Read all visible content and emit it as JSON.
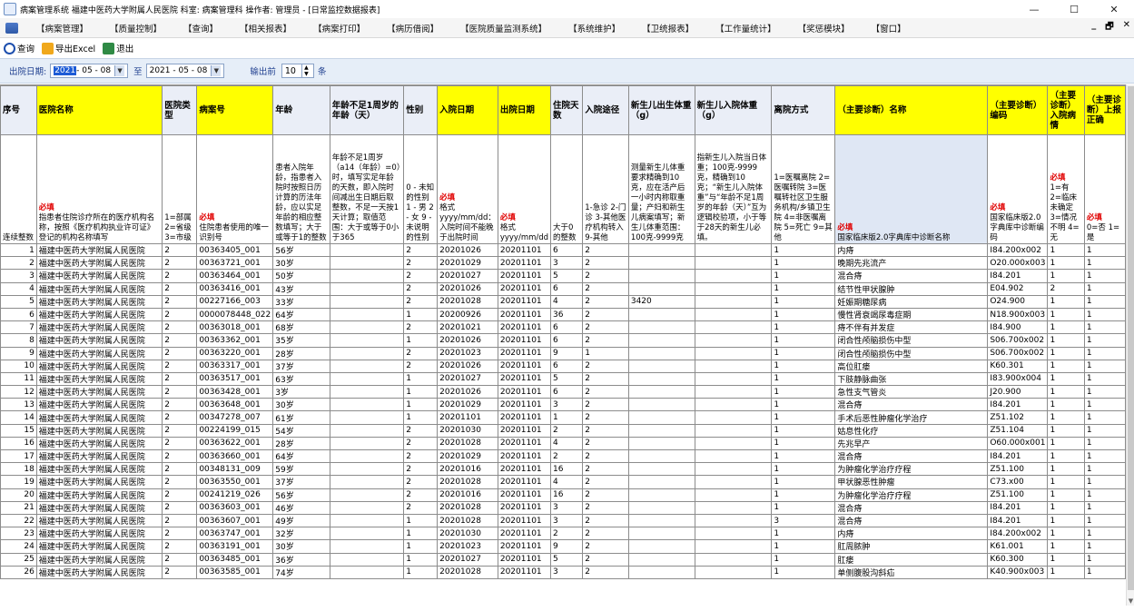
{
  "window": {
    "title": "病案管理系统 福建中医药大学附属人民医院 科室: 病案管理科 操作者: 管理员 - [日常监控数据报表]",
    "min_label": "—",
    "max_label": "☐",
    "close_label": "✕"
  },
  "menu": {
    "items": [
      "【病案管理】",
      "【质量控制】",
      "【查询】",
      "【相关报表】",
      "【病案打印】",
      "【病历借阅】",
      "【医院质量监测系统】",
      "【系统维护】",
      "【卫统报表】",
      "【工作量统计】",
      "【奖惩模块】",
      "【窗口】"
    ],
    "mdi_min": "_",
    "mdi_restore": "🗗",
    "mdi_close": "✕"
  },
  "toolbar": {
    "query": "查询",
    "export": "导出Excel",
    "exit": "退出"
  },
  "filter": {
    "label": "出院日期:",
    "from_year": "2021",
    "from_rest": " - 05 - 08",
    "to_label": "至",
    "to_date": "2021 - 05 - 08",
    "top_label": "输出前",
    "top_value": "10",
    "unit": "条"
  },
  "columns": [
    {
      "h": "序号",
      "d": "连续整数",
      "req": ""
    },
    {
      "h": "医院名称",
      "d": "指患者住院诊疗所在的医疗机构名称，按照《医疗机构执业许可证》登记的机构名称填写",
      "req": "必填"
    },
    {
      "h": "医院类型",
      "d": "1=部属 2=省级 3=市级",
      "req": ""
    },
    {
      "h": "病案号",
      "d": "住院患者使用的唯一识别号",
      "req": "必填"
    },
    {
      "h": "年龄",
      "d": "患者入院年龄，指患者入院时按照日历计算的历法年龄，应以实足年龄的相应整数填写；大于或等于1的整数",
      "req": ""
    },
    {
      "h": "年龄不足1周岁的年龄（天）",
      "d": "年龄不足1周岁（a14（年龄）=0）时，填写实足年龄的天数，即入院时间减出生日期后取整数，不足一天按1天计算；取值范围：大于或等于0小于365",
      "req": ""
    },
    {
      "h": "性别",
      "d": "0 - 未知的性别 1 - 男 2 - 女 9 - 未说明的性别",
      "req": ""
    },
    {
      "h": "入院日期",
      "d": "格式yyyy/mm/dd：入院时间不能晚于出院时间",
      "req": "必填"
    },
    {
      "h": "出院日期",
      "d": "格式yyyy/mm/dd",
      "req": "必填"
    },
    {
      "h": "住院天数",
      "d": "大于0的整数",
      "req": ""
    },
    {
      "h": "入院途径",
      "d": "1-急诊 2-门诊 3-其他医疗机构转入 9-其他",
      "req": ""
    },
    {
      "h": "新生儿出生体重（g）",
      "d": "测量新生儿体重要求精确到10克，应在活产后一小时内称取重量；产妇和新生儿病案填写；新生儿体重范围：100克-9999克",
      "req": ""
    },
    {
      "h": "新生儿入院体重（g）",
      "d": "指新生儿入院当日体重；100克-9999克，精确到10克；“新生儿入院体重”与“年龄不足1周岁的年龄（天）”互为逻辑校验项，小于等于28天的新生儿必填。",
      "req": ""
    },
    {
      "h": "离院方式",
      "d": "1=医嘱离院 2=医嘱转院 3=医嘱转社区卫生服务机构/乡镇卫生院 4=非医嘱离院 5=死亡 9=其他",
      "req": ""
    },
    {
      "h": "（主要诊断）名称",
      "d": "国家临床版2.0字典库中诊断名称",
      "req": "必填"
    },
    {
      "h": "（主要诊断）编码",
      "d": "国家临床版2.0字典库中诊断编码",
      "req": "必填"
    },
    {
      "h": "（主要诊断）入院病情",
      "d": "1=有 2=临床未确定 3=情况不明 4=无",
      "req": "必填"
    },
    {
      "h": "（主要诊断）上报正确",
      "d": "0=否 1=是",
      "req": "必填"
    }
  ],
  "rows": [
    [
      "1",
      "福建中医药大学附属人民医院",
      "2",
      "00363405_001",
      "56岁",
      "",
      "2",
      "20201026",
      "20201101",
      "6",
      "2",
      "",
      "",
      "1",
      "内痔",
      "I84.200x002",
      "1",
      "1"
    ],
    [
      "2",
      "福建中医药大学附属人民医院",
      "2",
      "00363721_001",
      "30岁",
      "",
      "2",
      "20201029",
      "20201101",
      "3",
      "2",
      "",
      "",
      "1",
      "晚期先兆流产",
      "O20.000x003",
      "1",
      "1"
    ],
    [
      "3",
      "福建中医药大学附属人民医院",
      "2",
      "00363464_001",
      "50岁",
      "",
      "2",
      "20201027",
      "20201101",
      "5",
      "2",
      "",
      "",
      "1",
      "混合痔",
      "I84.201",
      "1",
      "1"
    ],
    [
      "4",
      "福建中医药大学附属人民医院",
      "2",
      "00363416_001",
      "43岁",
      "",
      "2",
      "20201026",
      "20201101",
      "6",
      "2",
      "",
      "",
      "1",
      "结节性甲状腺肿",
      "E04.902",
      "2",
      "1"
    ],
    [
      "5",
      "福建中医药大学附属人民医院",
      "2",
      "00227166_003",
      "33岁",
      "",
      "2",
      "20201028",
      "20201101",
      "4",
      "2",
      "3420",
      "",
      "1",
      "妊娠期糖尿病",
      "O24.900",
      "1",
      "1"
    ],
    [
      "6",
      "福建中医药大学附属人民医院",
      "2",
      "0000078448_022",
      "64岁",
      "",
      "1",
      "20200926",
      "20201101",
      "36",
      "2",
      "",
      "",
      "1",
      "慢性肾衰竭尿毒症期",
      "N18.900x003",
      "1",
      "1"
    ],
    [
      "7",
      "福建中医药大学附属人民医院",
      "2",
      "00363018_001",
      "68岁",
      "",
      "2",
      "20201021",
      "20201101",
      "6",
      "2",
      "",
      "",
      "1",
      "痔不伴有并发症",
      "I84.900",
      "1",
      "1"
    ],
    [
      "8",
      "福建中医药大学附属人民医院",
      "2",
      "00363362_001",
      "35岁",
      "",
      "1",
      "20201026",
      "20201101",
      "6",
      "2",
      "",
      "",
      "1",
      "闭合性颅脑损伤中型",
      "S06.700x002",
      "1",
      "1"
    ],
    [
      "9",
      "福建中医药大学附属人民医院",
      "2",
      "00363220_001",
      "28岁",
      "",
      "2",
      "20201023",
      "20201101",
      "9",
      "1",
      "",
      "",
      "1",
      "闭合性颅脑损伤中型",
      "S06.700x002",
      "1",
      "1"
    ],
    [
      "10",
      "福建中医药大学附属人民医院",
      "2",
      "00363317_001",
      "37岁",
      "",
      "2",
      "20201026",
      "20201101",
      "6",
      "2",
      "",
      "",
      "1",
      "高位肛瘘",
      "K60.301",
      "1",
      "1"
    ],
    [
      "11",
      "福建中医药大学附属人民医院",
      "2",
      "00363517_001",
      "63岁",
      "",
      "1",
      "20201027",
      "20201101",
      "5",
      "2",
      "",
      "",
      "1",
      "下肢静脉曲张",
      "I83.900x004",
      "1",
      "1"
    ],
    [
      "12",
      "福建中医药大学附属人民医院",
      "2",
      "00363428_001",
      "3岁",
      "",
      "1",
      "20201026",
      "20201101",
      "6",
      "2",
      "",
      "",
      "1",
      "急性支气管炎",
      "J20.900",
      "1",
      "1"
    ],
    [
      "13",
      "福建中医药大学附属人民医院",
      "2",
      "00363648_001",
      "30岁",
      "",
      "1",
      "20201029",
      "20201101",
      "3",
      "2",
      "",
      "",
      "1",
      "混合痔",
      "I84.201",
      "1",
      "1"
    ],
    [
      "14",
      "福建中医药大学附属人民医院",
      "2",
      "00347278_007",
      "61岁",
      "",
      "1",
      "20201101",
      "20201101",
      "1",
      "2",
      "",
      "",
      "1",
      "手术后恶性肿瘤化学治疗",
      "Z51.102",
      "1",
      "1"
    ],
    [
      "15",
      "福建中医药大学附属人民医院",
      "2",
      "00224199_015",
      "54岁",
      "",
      "2",
      "20201030",
      "20201101",
      "2",
      "2",
      "",
      "",
      "1",
      "姑息性化疗",
      "Z51.104",
      "1",
      "1"
    ],
    [
      "16",
      "福建中医药大学附属人民医院",
      "2",
      "00363622_001",
      "28岁",
      "",
      "2",
      "20201028",
      "20201101",
      "4",
      "2",
      "",
      "",
      "1",
      "先兆早产",
      "O60.000x001",
      "1",
      "1"
    ],
    [
      "17",
      "福建中医药大学附属人民医院",
      "2",
      "00363660_001",
      "64岁",
      "",
      "2",
      "20201029",
      "20201101",
      "2",
      "2",
      "",
      "",
      "1",
      "混合痔",
      "I84.201",
      "1",
      "1"
    ],
    [
      "18",
      "福建中医药大学附属人民医院",
      "2",
      "00348131_009",
      "59岁",
      "",
      "2",
      "20201016",
      "20201101",
      "16",
      "2",
      "",
      "",
      "1",
      "为肿瘤化学治疗疗程",
      "Z51.100",
      "1",
      "1"
    ],
    [
      "19",
      "福建中医药大学附属人民医院",
      "2",
      "00363550_001",
      "37岁",
      "",
      "2",
      "20201028",
      "20201101",
      "4",
      "2",
      "",
      "",
      "1",
      "甲状腺恶性肿瘤",
      "C73.x00",
      "1",
      "1"
    ],
    [
      "20",
      "福建中医药大学附属人民医院",
      "2",
      "00241219_026",
      "56岁",
      "",
      "2",
      "20201016",
      "20201101",
      "16",
      "2",
      "",
      "",
      "1",
      "为肿瘤化学治疗疗程",
      "Z51.100",
      "1",
      "1"
    ],
    [
      "21",
      "福建中医药大学附属人民医院",
      "2",
      "00363603_001",
      "46岁",
      "",
      "2",
      "20201028",
      "20201101",
      "3",
      "2",
      "",
      "",
      "1",
      "混合痔",
      "I84.201",
      "1",
      "1"
    ],
    [
      "22",
      "福建中医药大学附属人民医院",
      "2",
      "00363607_001",
      "49岁",
      "",
      "1",
      "20201028",
      "20201101",
      "3",
      "2",
      "",
      "",
      "3",
      "混合痔",
      "I84.201",
      "1",
      "1"
    ],
    [
      "23",
      "福建中医药大学附属人民医院",
      "2",
      "00363747_001",
      "32岁",
      "",
      "1",
      "20201030",
      "20201101",
      "2",
      "2",
      "",
      "",
      "1",
      "内痔",
      "I84.200x002",
      "1",
      "1"
    ],
    [
      "24",
      "福建中医药大学附属人民医院",
      "2",
      "00363191_001",
      "30岁",
      "",
      "1",
      "20201023",
      "20201101",
      "9",
      "2",
      "",
      "",
      "1",
      "肛周脓肿",
      "K61.001",
      "1",
      "1"
    ],
    [
      "25",
      "福建中医药大学附属人民医院",
      "2",
      "00363485_001",
      "36岁",
      "",
      "1",
      "20201027",
      "20201101",
      "5",
      "2",
      "",
      "",
      "1",
      "肛瘘",
      "K60.300",
      "1",
      "1"
    ],
    [
      "26",
      "福建中医药大学附属人民医院",
      "2",
      "00363585_001",
      "74岁",
      "",
      "1",
      "20201028",
      "20201101",
      "3",
      "2",
      "",
      "",
      "1",
      "单侧腹股沟斜疝",
      "K40.900x003",
      "1",
      "1"
    ]
  ]
}
